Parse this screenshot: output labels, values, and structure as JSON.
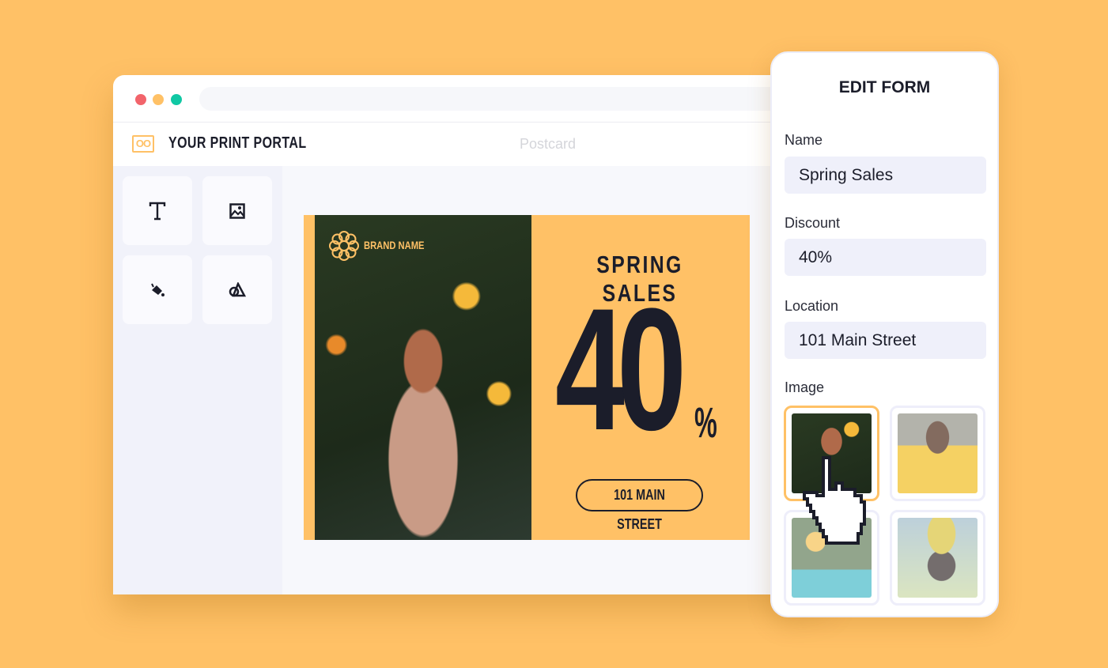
{
  "window": {
    "dots": [
      "#F2646B",
      "#FFC166",
      "#10C8A4"
    ]
  },
  "header": {
    "logo_text": "OO",
    "brand": "YOUR PRINT PORTAL",
    "document": "Postcard"
  },
  "tools": [
    {
      "icon": "text-icon"
    },
    {
      "icon": "image-icon"
    },
    {
      "icon": "paint-bucket-icon"
    },
    {
      "icon": "shapes-icon"
    }
  ],
  "postcard": {
    "brand_name": "BRAND NAME",
    "headline": "SPRING SALES",
    "discount_number": "40",
    "percent": "%",
    "address": "101 MAIN STREET",
    "color": "#FFC166"
  },
  "form": {
    "title": "EDIT FORM",
    "fields": [
      {
        "label": "Name",
        "value": "Spring Sales"
      },
      {
        "label": "Discount",
        "value": "40%"
      },
      {
        "label": "Location",
        "value": "101 Main Street"
      }
    ],
    "image_label": "Image",
    "selected_image": 0,
    "image_count": 4
  }
}
